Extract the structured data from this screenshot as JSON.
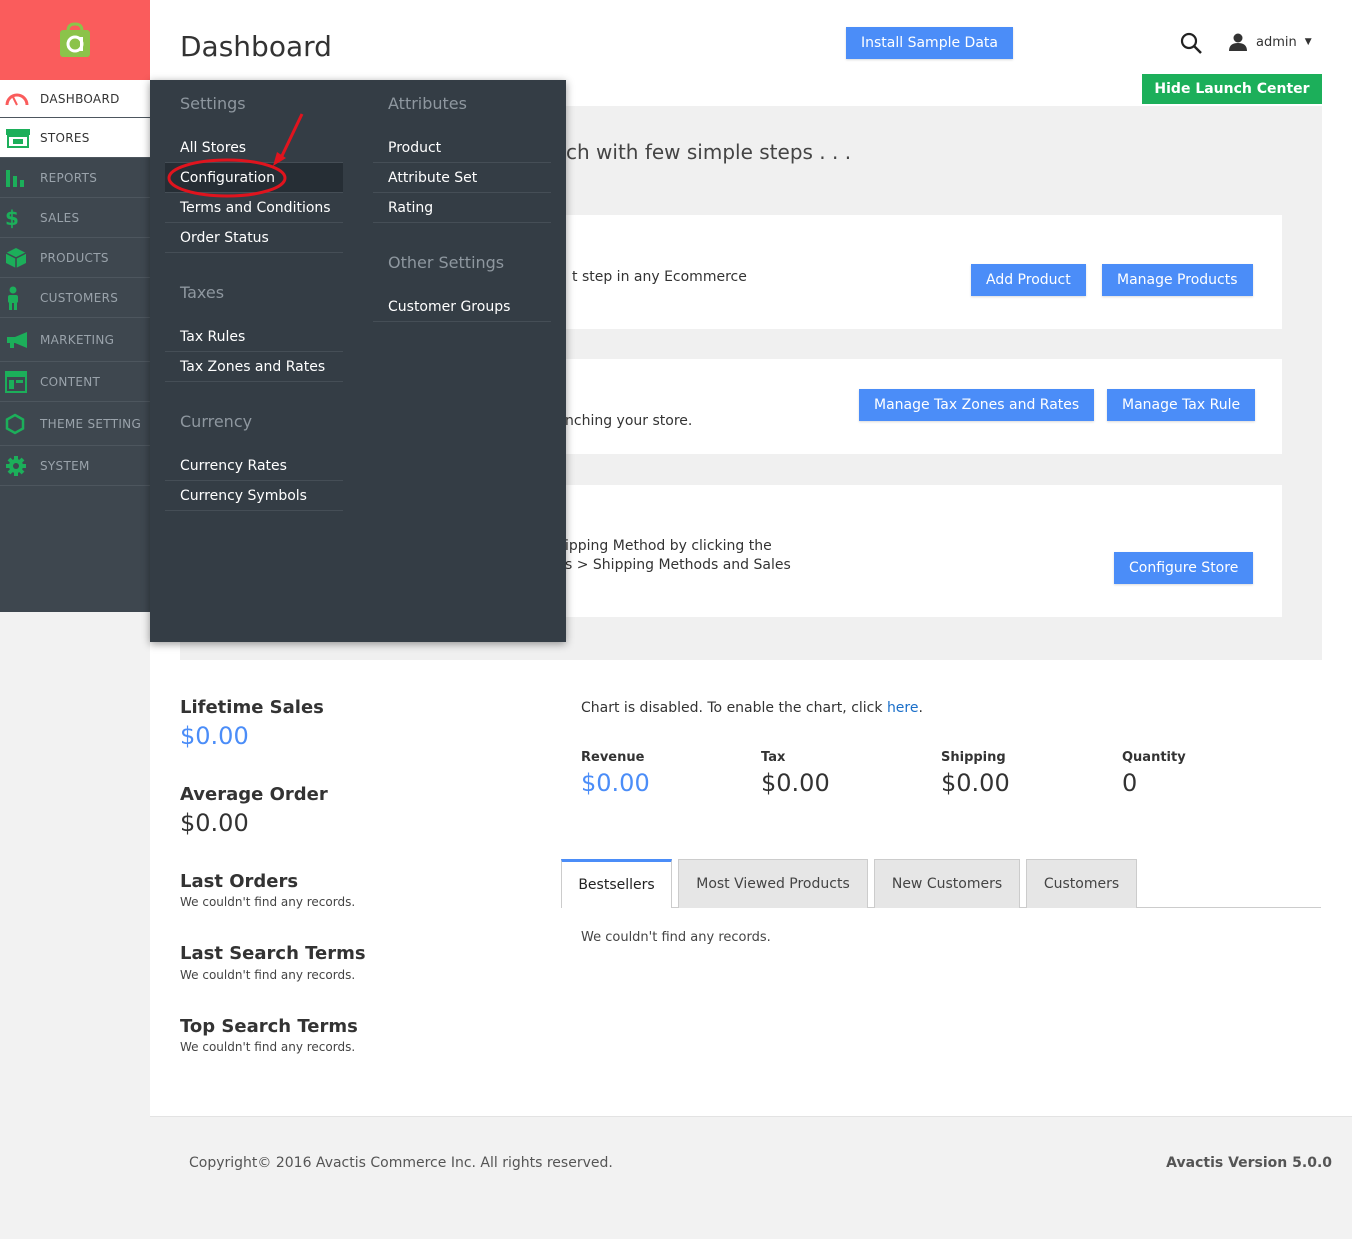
{
  "page": {
    "title": "Dashboard"
  },
  "header": {
    "install_label": "Install Sample Data",
    "user_name": "admin",
    "hide_launch_label": "Hide Launch Center"
  },
  "sidebar": {
    "items": [
      {
        "label": "DASHBOARD",
        "icon": "speedometer-icon"
      },
      {
        "label": "STORES",
        "icon": "storefront-icon"
      },
      {
        "label": "REPORTS",
        "icon": "bar-chart-icon"
      },
      {
        "label": "SALES",
        "icon": "dollar-icon"
      },
      {
        "label": "PRODUCTS",
        "icon": "box-icon"
      },
      {
        "label": "CUSTOMERS",
        "icon": "person-icon"
      },
      {
        "label": "MARKETING",
        "icon": "megaphone-icon"
      },
      {
        "label": "CONTENT",
        "icon": "layout-icon"
      },
      {
        "label": "THEME SETTING",
        "icon": "hexagon-icon"
      },
      {
        "label": "SYSTEM",
        "icon": "gear-icon"
      }
    ]
  },
  "dropdown": {
    "settings_head": "Settings",
    "settings_links": [
      "All Stores",
      "Configuration",
      "Terms and Conditions",
      "Order Status"
    ],
    "taxes_head": "Taxes",
    "taxes_links": [
      "Tax Rules",
      "Tax Zones and Rates"
    ],
    "currency_head": "Currency",
    "currency_links": [
      "Currency Rates",
      "Currency Symbols"
    ],
    "attributes_head": "Attributes",
    "attributes_links": [
      "Product",
      "Attribute Set",
      "Rating"
    ],
    "other_head": "Other Settings",
    "other_links": [
      "Customer Groups"
    ]
  },
  "launch": {
    "heading": "ch with few simple steps . . .",
    "card1_text": "t step in any Ecommerce",
    "add_product": "Add Product",
    "manage_products": "Manage Products",
    "card2_text": "nching your store.",
    "manage_tax_zones": "Manage Tax Zones and Rates",
    "manage_tax_rule": "Manage Tax Rule",
    "card3_line1": "ipping Method by clicking the",
    "card3_line2": "s > Shipping Methods and Sales",
    "configure_store": "Configure Store"
  },
  "stats": {
    "lifetime_label": "Lifetime Sales",
    "lifetime_value": "$0.00",
    "average_label": "Average Order",
    "average_value": "$0.00",
    "last_orders_label": "Last Orders",
    "last_search_label": "Last Search Terms",
    "top_search_label": "Top Search Terms",
    "no_records": "We couldn't find any records."
  },
  "chart": {
    "disabled_text": "Chart is disabled. To enable the chart, click ",
    "here_link": "here",
    "period": ".",
    "revenue_label": "Revenue",
    "revenue_value": "$0.00",
    "tax_label": "Tax",
    "tax_value": "$0.00",
    "shipping_label": "Shipping",
    "shipping_value": "$0.00",
    "quantity_label": "Quantity",
    "quantity_value": "0"
  },
  "tabs": [
    "Bestsellers",
    "Most Viewed Products",
    "New Customers",
    "Customers"
  ],
  "tab_content": "We couldn't find any records.",
  "footer": {
    "copyright": "Copyright© 2016 Avactis Commerce Inc. All rights reserved.",
    "version": "Avactis Version 5.0.0"
  },
  "colors": {
    "accent": "#4b8df8",
    "green": "#1caf5a",
    "brand": "#fa5c5c",
    "sidebar": "#3e474f",
    "dropdown": "#343d45",
    "annotation": "#e0141e"
  }
}
